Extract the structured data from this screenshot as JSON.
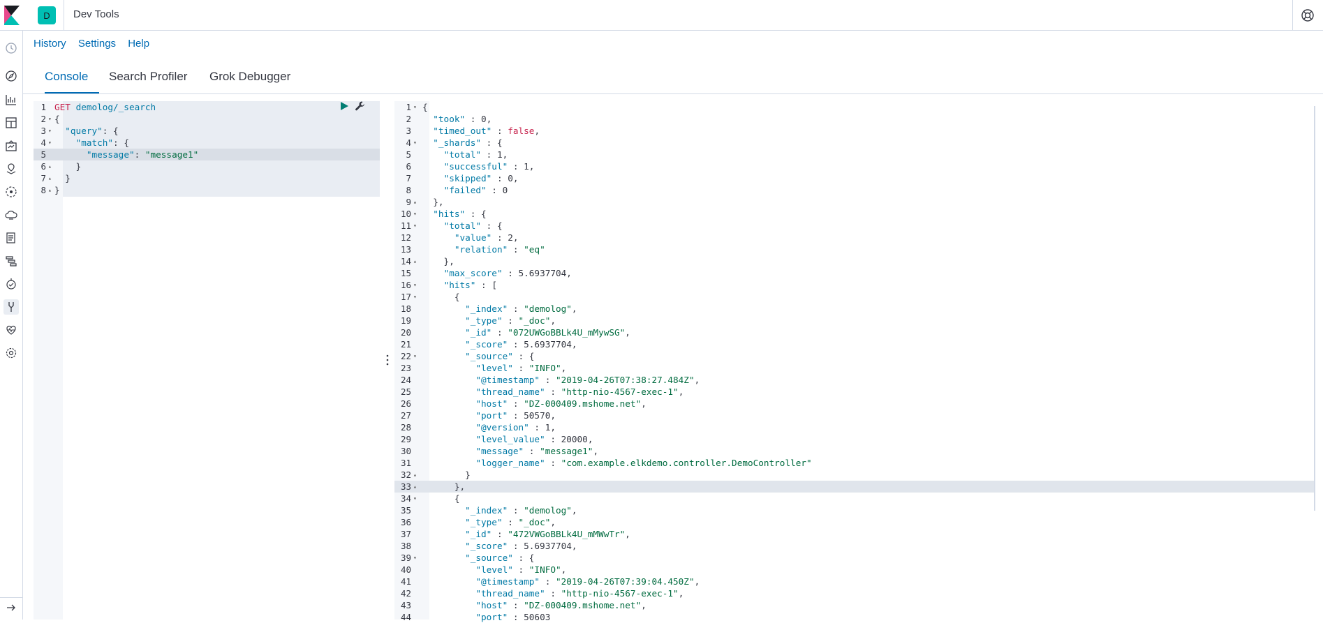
{
  "app": {
    "avatar_letter": "D",
    "title": "Dev Tools"
  },
  "menu": {
    "history": "History",
    "settings": "Settings",
    "help": "Help"
  },
  "tabs": [
    {
      "label": "Console",
      "selected": true
    },
    {
      "label": "Search Profiler",
      "selected": false
    },
    {
      "label": "Grok Debugger",
      "selected": false
    }
  ],
  "nav_icons": [
    "clock-icon",
    "compass-icon",
    "visualize-icon",
    "dashboard-icon",
    "canvas-icon",
    "maps-icon",
    "ml-icon",
    "infrastructure-icon",
    "logs-icon",
    "apm-icon",
    "uptime-icon",
    "devtools-icon",
    "monitoring-icon",
    "management-icon"
  ],
  "request_editor": {
    "lines": [
      [
        [
          "k-method",
          "GET"
        ],
        [
          "punc",
          " "
        ],
        [
          "k-path",
          "demolog/_search"
        ]
      ],
      [
        [
          "punc",
          "{"
        ]
      ],
      [
        [
          "punc",
          "  "
        ],
        [
          "k-key",
          "\"query\""
        ],
        [
          "punc",
          ": {"
        ]
      ],
      [
        [
          "punc",
          "    "
        ],
        [
          "k-key",
          "\"match\""
        ],
        [
          "punc",
          ": {"
        ]
      ],
      [
        [
          "punc",
          "      "
        ],
        [
          "k-key",
          "\"message\""
        ],
        [
          "punc",
          ": "
        ],
        [
          "k-str",
          "\"message1\""
        ]
      ],
      [
        [
          "punc",
          "    }"
        ]
      ],
      [
        [
          "punc",
          "  }"
        ]
      ],
      [
        [
          "punc",
          "}"
        ]
      ]
    ],
    "folds": [
      "",
      "▾",
      "▾",
      "▾",
      "",
      "▴",
      "▴",
      "▴"
    ]
  },
  "response_editor": {
    "lines": [
      [
        [
          "punc",
          "{"
        ]
      ],
      [
        [
          "punc",
          "  "
        ],
        [
          "k-key",
          "\"took\""
        ],
        [
          "punc",
          " : "
        ],
        [
          "k-num",
          "0"
        ],
        [
          "punc",
          ","
        ]
      ],
      [
        [
          "punc",
          "  "
        ],
        [
          "k-key",
          "\"timed_out\""
        ],
        [
          "punc",
          " : "
        ],
        [
          "k-bool",
          "false"
        ],
        [
          "punc",
          ","
        ]
      ],
      [
        [
          "punc",
          "  "
        ],
        [
          "k-key",
          "\"_shards\""
        ],
        [
          "punc",
          " : {"
        ]
      ],
      [
        [
          "punc",
          "    "
        ],
        [
          "k-key",
          "\"total\""
        ],
        [
          "punc",
          " : "
        ],
        [
          "k-num",
          "1"
        ],
        [
          "punc",
          ","
        ]
      ],
      [
        [
          "punc",
          "    "
        ],
        [
          "k-key",
          "\"successful\""
        ],
        [
          "punc",
          " : "
        ],
        [
          "k-num",
          "1"
        ],
        [
          "punc",
          ","
        ]
      ],
      [
        [
          "punc",
          "    "
        ],
        [
          "k-key",
          "\"skipped\""
        ],
        [
          "punc",
          " : "
        ],
        [
          "k-num",
          "0"
        ],
        [
          "punc",
          ","
        ]
      ],
      [
        [
          "punc",
          "    "
        ],
        [
          "k-key",
          "\"failed\""
        ],
        [
          "punc",
          " : "
        ],
        [
          "k-num",
          "0"
        ]
      ],
      [
        [
          "punc",
          "  },"
        ]
      ],
      [
        [
          "punc",
          "  "
        ],
        [
          "k-key",
          "\"hits\""
        ],
        [
          "punc",
          " : {"
        ]
      ],
      [
        [
          "punc",
          "    "
        ],
        [
          "k-key",
          "\"total\""
        ],
        [
          "punc",
          " : {"
        ]
      ],
      [
        [
          "punc",
          "      "
        ],
        [
          "k-key",
          "\"value\""
        ],
        [
          "punc",
          " : "
        ],
        [
          "k-num",
          "2"
        ],
        [
          "punc",
          ","
        ]
      ],
      [
        [
          "punc",
          "      "
        ],
        [
          "k-key",
          "\"relation\""
        ],
        [
          "punc",
          " : "
        ],
        [
          "k-str",
          "\"eq\""
        ]
      ],
      [
        [
          "punc",
          "    },"
        ]
      ],
      [
        [
          "punc",
          "    "
        ],
        [
          "k-key",
          "\"max_score\""
        ],
        [
          "punc",
          " : "
        ],
        [
          "k-num",
          "5.6937704"
        ],
        [
          "punc",
          ","
        ]
      ],
      [
        [
          "punc",
          "    "
        ],
        [
          "k-key",
          "\"hits\""
        ],
        [
          "punc",
          " : ["
        ]
      ],
      [
        [
          "punc",
          "      {"
        ]
      ],
      [
        [
          "punc",
          "        "
        ],
        [
          "k-key",
          "\"_index\""
        ],
        [
          "punc",
          " : "
        ],
        [
          "k-str",
          "\"demolog\""
        ],
        [
          "punc",
          ","
        ]
      ],
      [
        [
          "punc",
          "        "
        ],
        [
          "k-key",
          "\"_type\""
        ],
        [
          "punc",
          " : "
        ],
        [
          "k-str",
          "\"_doc\""
        ],
        [
          "punc",
          ","
        ]
      ],
      [
        [
          "punc",
          "        "
        ],
        [
          "k-key",
          "\"_id\""
        ],
        [
          "punc",
          " : "
        ],
        [
          "k-str",
          "\"072UWGoBBLk4U_mMywSG\""
        ],
        [
          "punc",
          ","
        ]
      ],
      [
        [
          "punc",
          "        "
        ],
        [
          "k-key",
          "\"_score\""
        ],
        [
          "punc",
          " : "
        ],
        [
          "k-num",
          "5.6937704"
        ],
        [
          "punc",
          ","
        ]
      ],
      [
        [
          "punc",
          "        "
        ],
        [
          "k-key",
          "\"_source\""
        ],
        [
          "punc",
          " : {"
        ]
      ],
      [
        [
          "punc",
          "          "
        ],
        [
          "k-key",
          "\"level\""
        ],
        [
          "punc",
          " : "
        ],
        [
          "k-str",
          "\"INFO\""
        ],
        [
          "punc",
          ","
        ]
      ],
      [
        [
          "punc",
          "          "
        ],
        [
          "k-key",
          "\"@timestamp\""
        ],
        [
          "punc",
          " : "
        ],
        [
          "k-str",
          "\"2019-04-26T07:38:27.484Z\""
        ],
        [
          "punc",
          ","
        ]
      ],
      [
        [
          "punc",
          "          "
        ],
        [
          "k-key",
          "\"thread_name\""
        ],
        [
          "punc",
          " : "
        ],
        [
          "k-str",
          "\"http-nio-4567-exec-1\""
        ],
        [
          "punc",
          ","
        ]
      ],
      [
        [
          "punc",
          "          "
        ],
        [
          "k-key",
          "\"host\""
        ],
        [
          "punc",
          " : "
        ],
        [
          "k-str",
          "\"DZ-000409.mshome.net\""
        ],
        [
          "punc",
          ","
        ]
      ],
      [
        [
          "punc",
          "          "
        ],
        [
          "k-key",
          "\"port\""
        ],
        [
          "punc",
          " : "
        ],
        [
          "k-num",
          "50570"
        ],
        [
          "punc",
          ","
        ]
      ],
      [
        [
          "punc",
          "          "
        ],
        [
          "k-key",
          "\"@version\""
        ],
        [
          "punc",
          " : "
        ],
        [
          "k-num",
          "1"
        ],
        [
          "punc",
          ","
        ]
      ],
      [
        [
          "punc",
          "          "
        ],
        [
          "k-key",
          "\"level_value\""
        ],
        [
          "punc",
          " : "
        ],
        [
          "k-num",
          "20000"
        ],
        [
          "punc",
          ","
        ]
      ],
      [
        [
          "punc",
          "          "
        ],
        [
          "k-key",
          "\"message\""
        ],
        [
          "punc",
          " : "
        ],
        [
          "k-str",
          "\"message1\""
        ],
        [
          "punc",
          ","
        ]
      ],
      [
        [
          "punc",
          "          "
        ],
        [
          "k-key",
          "\"logger_name\""
        ],
        [
          "punc",
          " : "
        ],
        [
          "k-str",
          "\"com.example.elkdemo.controller.DemoController\""
        ]
      ],
      [
        [
          "punc",
          "        }"
        ]
      ],
      [
        [
          "punc",
          "      },"
        ]
      ],
      [
        [
          "punc",
          "      {"
        ]
      ],
      [
        [
          "punc",
          "        "
        ],
        [
          "k-key",
          "\"_index\""
        ],
        [
          "punc",
          " : "
        ],
        [
          "k-str",
          "\"demolog\""
        ],
        [
          "punc",
          ","
        ]
      ],
      [
        [
          "punc",
          "        "
        ],
        [
          "k-key",
          "\"_type\""
        ],
        [
          "punc",
          " : "
        ],
        [
          "k-str",
          "\"_doc\""
        ],
        [
          "punc",
          ","
        ]
      ],
      [
        [
          "punc",
          "        "
        ],
        [
          "k-key",
          "\"_id\""
        ],
        [
          "punc",
          " : "
        ],
        [
          "k-str",
          "\"472VWGoBBLk4U_mMWwTr\""
        ],
        [
          "punc",
          ","
        ]
      ],
      [
        [
          "punc",
          "        "
        ],
        [
          "k-key",
          "\"_score\""
        ],
        [
          "punc",
          " : "
        ],
        [
          "k-num",
          "5.6937704"
        ],
        [
          "punc",
          ","
        ]
      ],
      [
        [
          "punc",
          "        "
        ],
        [
          "k-key",
          "\"_source\""
        ],
        [
          "punc",
          " : {"
        ]
      ],
      [
        [
          "punc",
          "          "
        ],
        [
          "k-key",
          "\"level\""
        ],
        [
          "punc",
          " : "
        ],
        [
          "k-str",
          "\"INFO\""
        ],
        [
          "punc",
          ","
        ]
      ],
      [
        [
          "punc",
          "          "
        ],
        [
          "k-key",
          "\"@timestamp\""
        ],
        [
          "punc",
          " : "
        ],
        [
          "k-str",
          "\"2019-04-26T07:39:04.450Z\""
        ],
        [
          "punc",
          ","
        ]
      ],
      [
        [
          "punc",
          "          "
        ],
        [
          "k-key",
          "\"thread_name\""
        ],
        [
          "punc",
          " : "
        ],
        [
          "k-str",
          "\"http-nio-4567-exec-1\""
        ],
        [
          "punc",
          ","
        ]
      ],
      [
        [
          "punc",
          "          "
        ],
        [
          "k-key",
          "\"host\""
        ],
        [
          "punc",
          " : "
        ],
        [
          "k-str",
          "\"DZ-000409.mshome.net\""
        ],
        [
          "punc",
          ","
        ]
      ],
      [
        [
          "punc",
          "          "
        ],
        [
          "k-key",
          "\"port\""
        ],
        [
          "punc",
          " : "
        ],
        [
          "k-num",
          "50603"
        ]
      ]
    ],
    "folds": [
      "▾",
      "",
      "",
      "▾",
      "",
      "",
      "",
      "",
      "▴",
      "▾",
      "▾",
      "",
      "",
      "▴",
      "",
      "▾",
      "▾",
      "",
      "",
      "",
      "",
      "▾",
      "",
      "",
      "",
      "",
      "",
      "",
      "",
      "",
      "",
      "▴",
      "▴",
      "▾",
      "",
      "",
      "",
      "",
      "▾",
      "",
      "",
      "",
      "",
      ""
    ]
  }
}
